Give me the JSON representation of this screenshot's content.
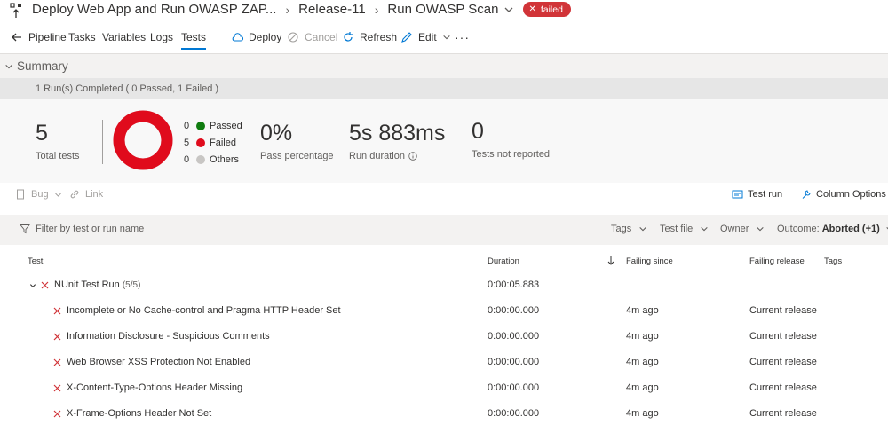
{
  "header": {
    "pipeline_name": "Deploy Web App and Run OWASP ZAP...",
    "release": "Release-11",
    "stage": "Run OWASP Scan",
    "status_badge": "failed"
  },
  "toolbar": {
    "back_label": "Pipeline",
    "tabs": [
      "Tasks",
      "Variables",
      "Logs",
      "Tests"
    ],
    "active_tab": "Tests",
    "deploy_label": "Deploy",
    "cancel_label": "Cancel",
    "refresh_label": "Refresh",
    "edit_label": "Edit",
    "more_label": "···"
  },
  "summary": {
    "title": "Summary",
    "run_status": "1 Run(s) Completed ( 0 Passed, 1 Failed )",
    "total_tests": {
      "value": "5",
      "label": "Total tests"
    },
    "legend": [
      {
        "count": "0",
        "label": "Passed",
        "color": "#107c10"
      },
      {
        "count": "5",
        "label": "Failed",
        "color": "#e00b1c"
      },
      {
        "count": "0",
        "label": "Others",
        "color": "#c8c6c4"
      }
    ],
    "pass_percentage": {
      "value": "0%",
      "label": "Pass percentage"
    },
    "run_duration": {
      "value": "5s 883ms",
      "label": "Run duration"
    },
    "not_reported": {
      "value": "0",
      "label": "Tests not reported"
    },
    "donut_failed_fraction": 1.0
  },
  "actions": {
    "bug_label": "Bug",
    "link_label": "Link",
    "test_run_label": "Test run",
    "column_options_label": "Column Options"
  },
  "filters": {
    "placeholder": "Filter by test or run name",
    "tags_label": "Tags",
    "test_file_label": "Test file",
    "owner_label": "Owner",
    "outcome_label": "Outcome:",
    "outcome_value": "Aborted (+1)"
  },
  "table": {
    "columns": {
      "test": "Test",
      "duration": "Duration",
      "failing_since": "Failing since",
      "failing_release": "Failing release",
      "tags": "Tags"
    },
    "group": {
      "name": "NUnit Test Run",
      "count": "(5/5)",
      "duration": "0:00:05.883"
    },
    "rows": [
      {
        "name": "Incomplete or No Cache-control and Pragma HTTP Header Set",
        "duration": "0:00:00.000",
        "failing_since": "4m ago",
        "failing_release": "Current release"
      },
      {
        "name": "Information Disclosure - Suspicious Comments",
        "duration": "0:00:00.000",
        "failing_since": "4m ago",
        "failing_release": "Current release"
      },
      {
        "name": "Web Browser XSS Protection Not Enabled",
        "duration": "0:00:00.000",
        "failing_since": "4m ago",
        "failing_release": "Current release"
      },
      {
        "name": "X-Content-Type-Options Header Missing",
        "duration": "0:00:00.000",
        "failing_since": "4m ago",
        "failing_release": "Current release"
      },
      {
        "name": "X-Frame-Options Header Not Set",
        "duration": "0:00:00.000",
        "failing_since": "4m ago",
        "failing_release": "Current release"
      }
    ]
  },
  "colors": {
    "accent": "#0078d4",
    "failed": "#d13438",
    "donut_failed": "#e00b1c"
  }
}
